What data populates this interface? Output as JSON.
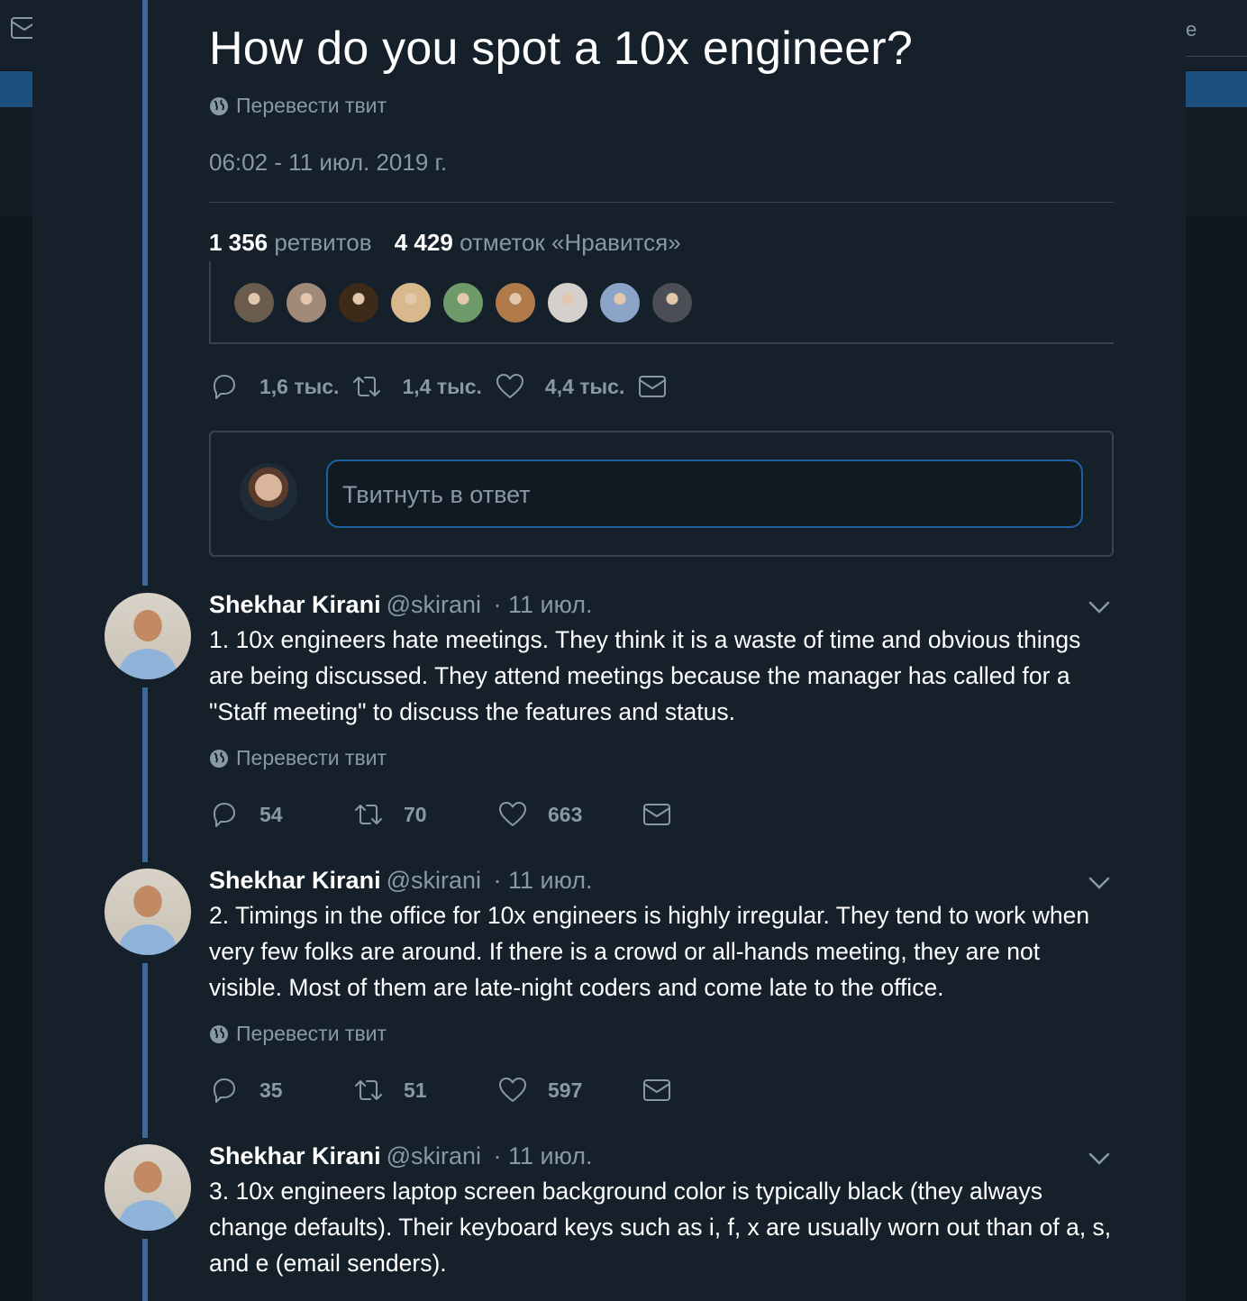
{
  "tweet": {
    "title": "How do you spot a 10x engineer?",
    "translate_label": "Перевести твит",
    "timestamp": "06:02 - 11 июл. 2019 г.",
    "retweets_count": "1 356",
    "retweets_label": "ретвитов",
    "likes_count": "4 429",
    "likes_label": "отметок «Нравится»",
    "likers": [
      "#6b5b4d",
      "#a08a7a",
      "#3d2a18",
      "#d9b88e",
      "#6e9a6a",
      "#b07a4a",
      "#d6d0cc",
      "#8aa3c6",
      "#4b4f55"
    ],
    "actions": {
      "reply": "1,6 тыс.",
      "retweet": "1,4 тыс.",
      "like": "4,4 тыс."
    }
  },
  "reply_box": {
    "placeholder": "Твитнуть в ответ"
  },
  "replies": [
    {
      "name": "Shekhar Kirani",
      "handle": "@skirani",
      "date": "· 11 июл.",
      "text": "1. 10x engineers hate meetings. They think it is a waste of time and obvious things are being discussed. They attend meetings because the manager has called for a \"Staff meeting\" to discuss the features and status.",
      "translate_label": "Перевести твит",
      "reply_count": "54",
      "retweet_count": "70",
      "like_count": "663"
    },
    {
      "name": "Shekhar Kirani",
      "handle": "@skirani",
      "date": "· 11 июл.",
      "text": "2. Timings in the office for 10x engineers is highly irregular. They tend to work when very few folks are around. If there is a crowd or all-hands meeting, they are not visible. Most of them are late-night coders and come late to the office.",
      "translate_label": "Перевести твит",
      "reply_count": "35",
      "retweet_count": "51",
      "like_count": "597"
    },
    {
      "name": "Shekhar Kirani",
      "handle": "@skirani",
      "date": "· 11 июл.",
      "text": "3. 10x engineers laptop screen background color is typically black (they always change defaults). Their keyboard keys such as i, f, x are usually worn out than of a, s, and e (email senders)."
    }
  ],
  "background": {
    "right_text": "e"
  },
  "colors": {
    "accent": "#1da1f2",
    "thread_line": "#3b6a99",
    "muted": "#8899a6",
    "panel": "#15202b"
  },
  "icons": [
    "globe-icon",
    "reply-icon",
    "retweet-icon",
    "heart-icon",
    "message-icon",
    "chevron-down-icon",
    "mail-icon"
  ]
}
